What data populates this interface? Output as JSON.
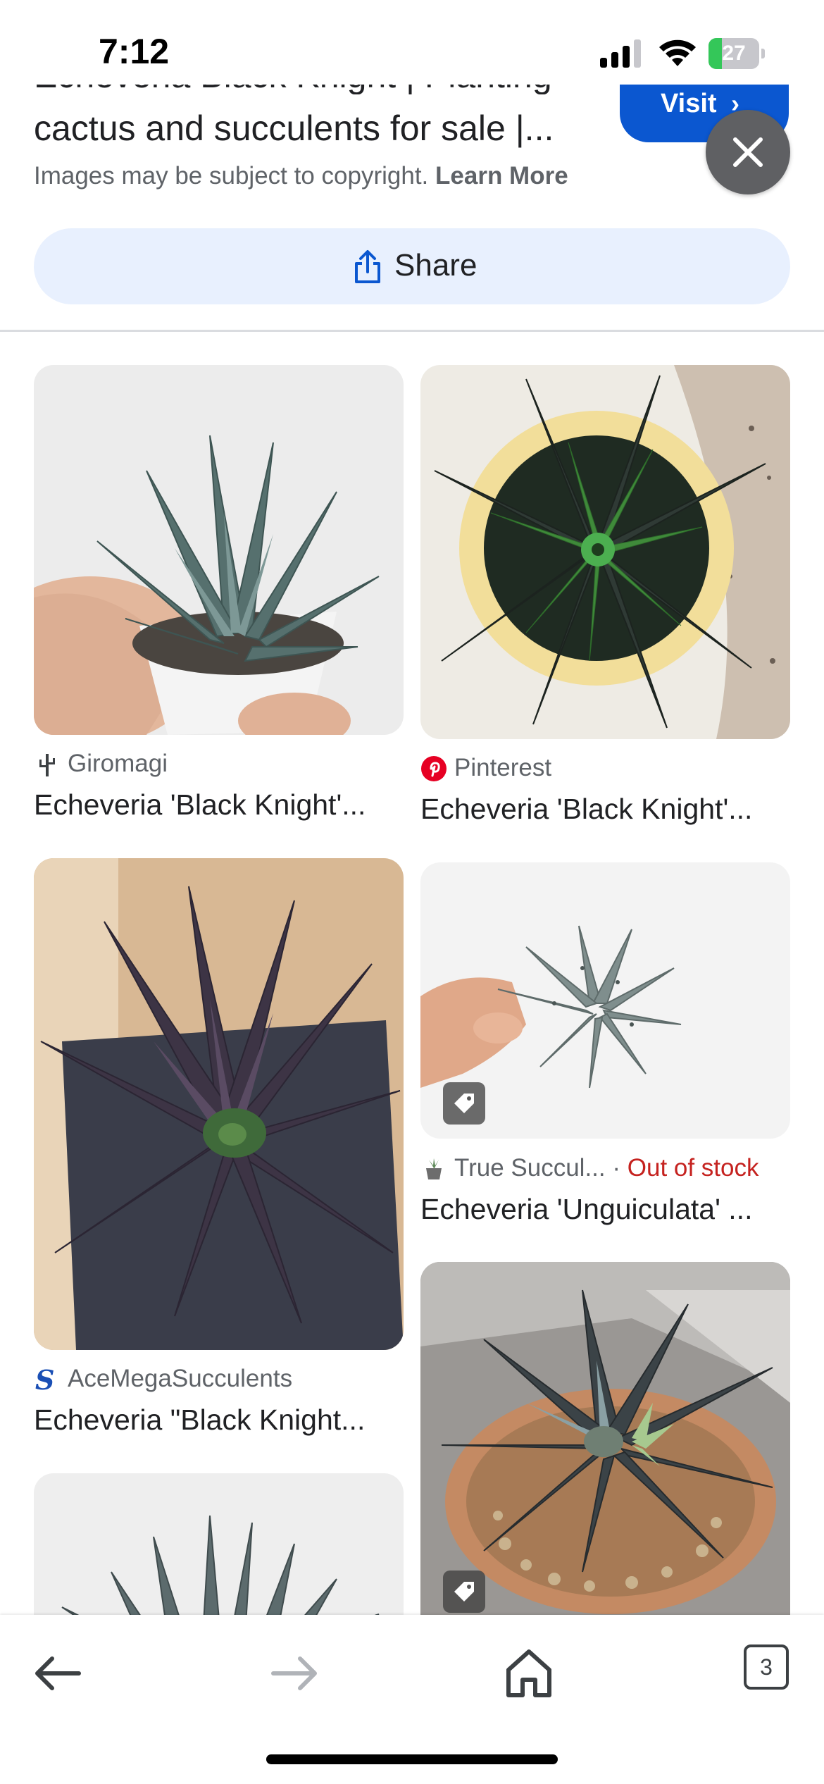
{
  "status_bar": {
    "time": "7:12",
    "battery_text": "27",
    "battery_level": 0.27,
    "battery_color": "#34c759"
  },
  "result": {
    "title_partial_line": "Echeveria Black Knight | Planting",
    "title": "cactus and succulents for sale |...",
    "visit_label": "Visit",
    "visit_icon": "chevron-right-icon",
    "close_icon": "close-icon",
    "copyright_text": "Images may be subject to copyright.",
    "learn_more_label": "Learn More",
    "share_label": "Share",
    "share_icon": "share-icon",
    "accent_color": "#0b57d0"
  },
  "grid": {
    "left": [
      {
        "source_icon": "cactus-icon",
        "source": "Giromagi",
        "title": "Echeveria 'Black Knight'..."
      },
      {
        "source_icon": "s-logo-icon",
        "source": "AceMegaSucculents",
        "title": "Echeveria \"Black Knight..."
      }
    ],
    "right": [
      {
        "source_icon": "pinterest-icon",
        "source": "Pinterest",
        "title": "Echeveria 'Black Knight'..."
      },
      {
        "source_icon": "succulent-pot-icon",
        "source": "True Succul...",
        "separator": "·",
        "stock_status": "Out of stock",
        "title": "Echeveria 'Unguiculata' ...",
        "badge_icon": "tag-icon"
      },
      {
        "badge_icon": "tag-icon"
      }
    ]
  },
  "toolbar": {
    "back_icon": "back-arrow-icon",
    "forward_icon": "forward-arrow-icon",
    "home_icon": "home-icon",
    "tab_count": "3"
  }
}
